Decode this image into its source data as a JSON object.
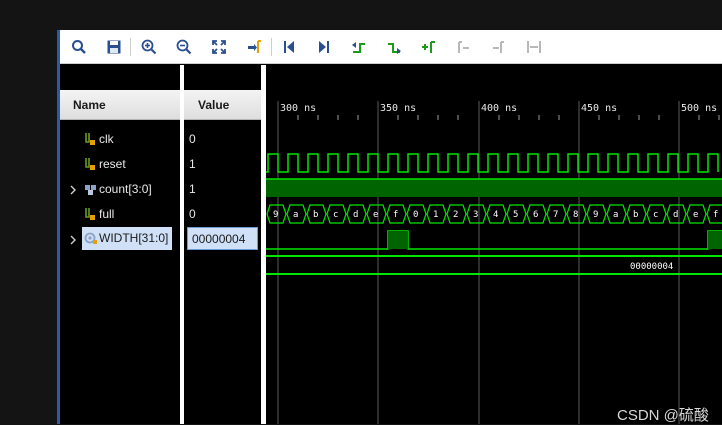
{
  "toolbar": {
    "icons": [
      "search-icon",
      "save-icon",
      "zoom-in-icon",
      "zoom-out-icon",
      "zoom-fit-icon",
      "go-to-cursor-icon",
      "go-to-start-icon",
      "go-to-end-icon",
      "previous-transition-icon",
      "next-transition-icon",
      "add-marker-icon",
      "previous-marker-icon",
      "next-marker-icon",
      "swap-cursors-icon"
    ]
  },
  "columns": {
    "name": "Name",
    "value": "Value"
  },
  "signals": [
    {
      "name": "clk",
      "value": "0",
      "icon": "single-bit-icon",
      "expandable": false
    },
    {
      "name": "reset",
      "value": "1",
      "icon": "single-bit-icon",
      "expandable": false
    },
    {
      "name": "count[3:0]",
      "value": "1",
      "icon": "bus-icon",
      "expandable": true
    },
    {
      "name": "full",
      "value": "0",
      "icon": "single-bit-icon",
      "expandable": false
    },
    {
      "name": "WIDTH[31:0]",
      "value": "00000004",
      "icon": "parameter-icon",
      "expandable": true
    }
  ],
  "timeline": {
    "ticks": [
      "300 ns",
      "350 ns",
      "400 ns",
      "450 ns",
      "500 ns"
    ]
  },
  "count_values": [
    "9",
    "a",
    "b",
    "c",
    "d",
    "e",
    "f",
    "0",
    "1",
    "2",
    "3",
    "4",
    "5",
    "6",
    "7",
    "8",
    "9",
    "a",
    "b",
    "c",
    "d",
    "e",
    "f"
  ],
  "width_bus_value": "00000004",
  "colors": {
    "waveform": "#00e600",
    "wave_dark": "#006400",
    "grid": "#5a5a5a",
    "selection": "#cfe0f7"
  },
  "watermark": "CSDN @硫酸"
}
